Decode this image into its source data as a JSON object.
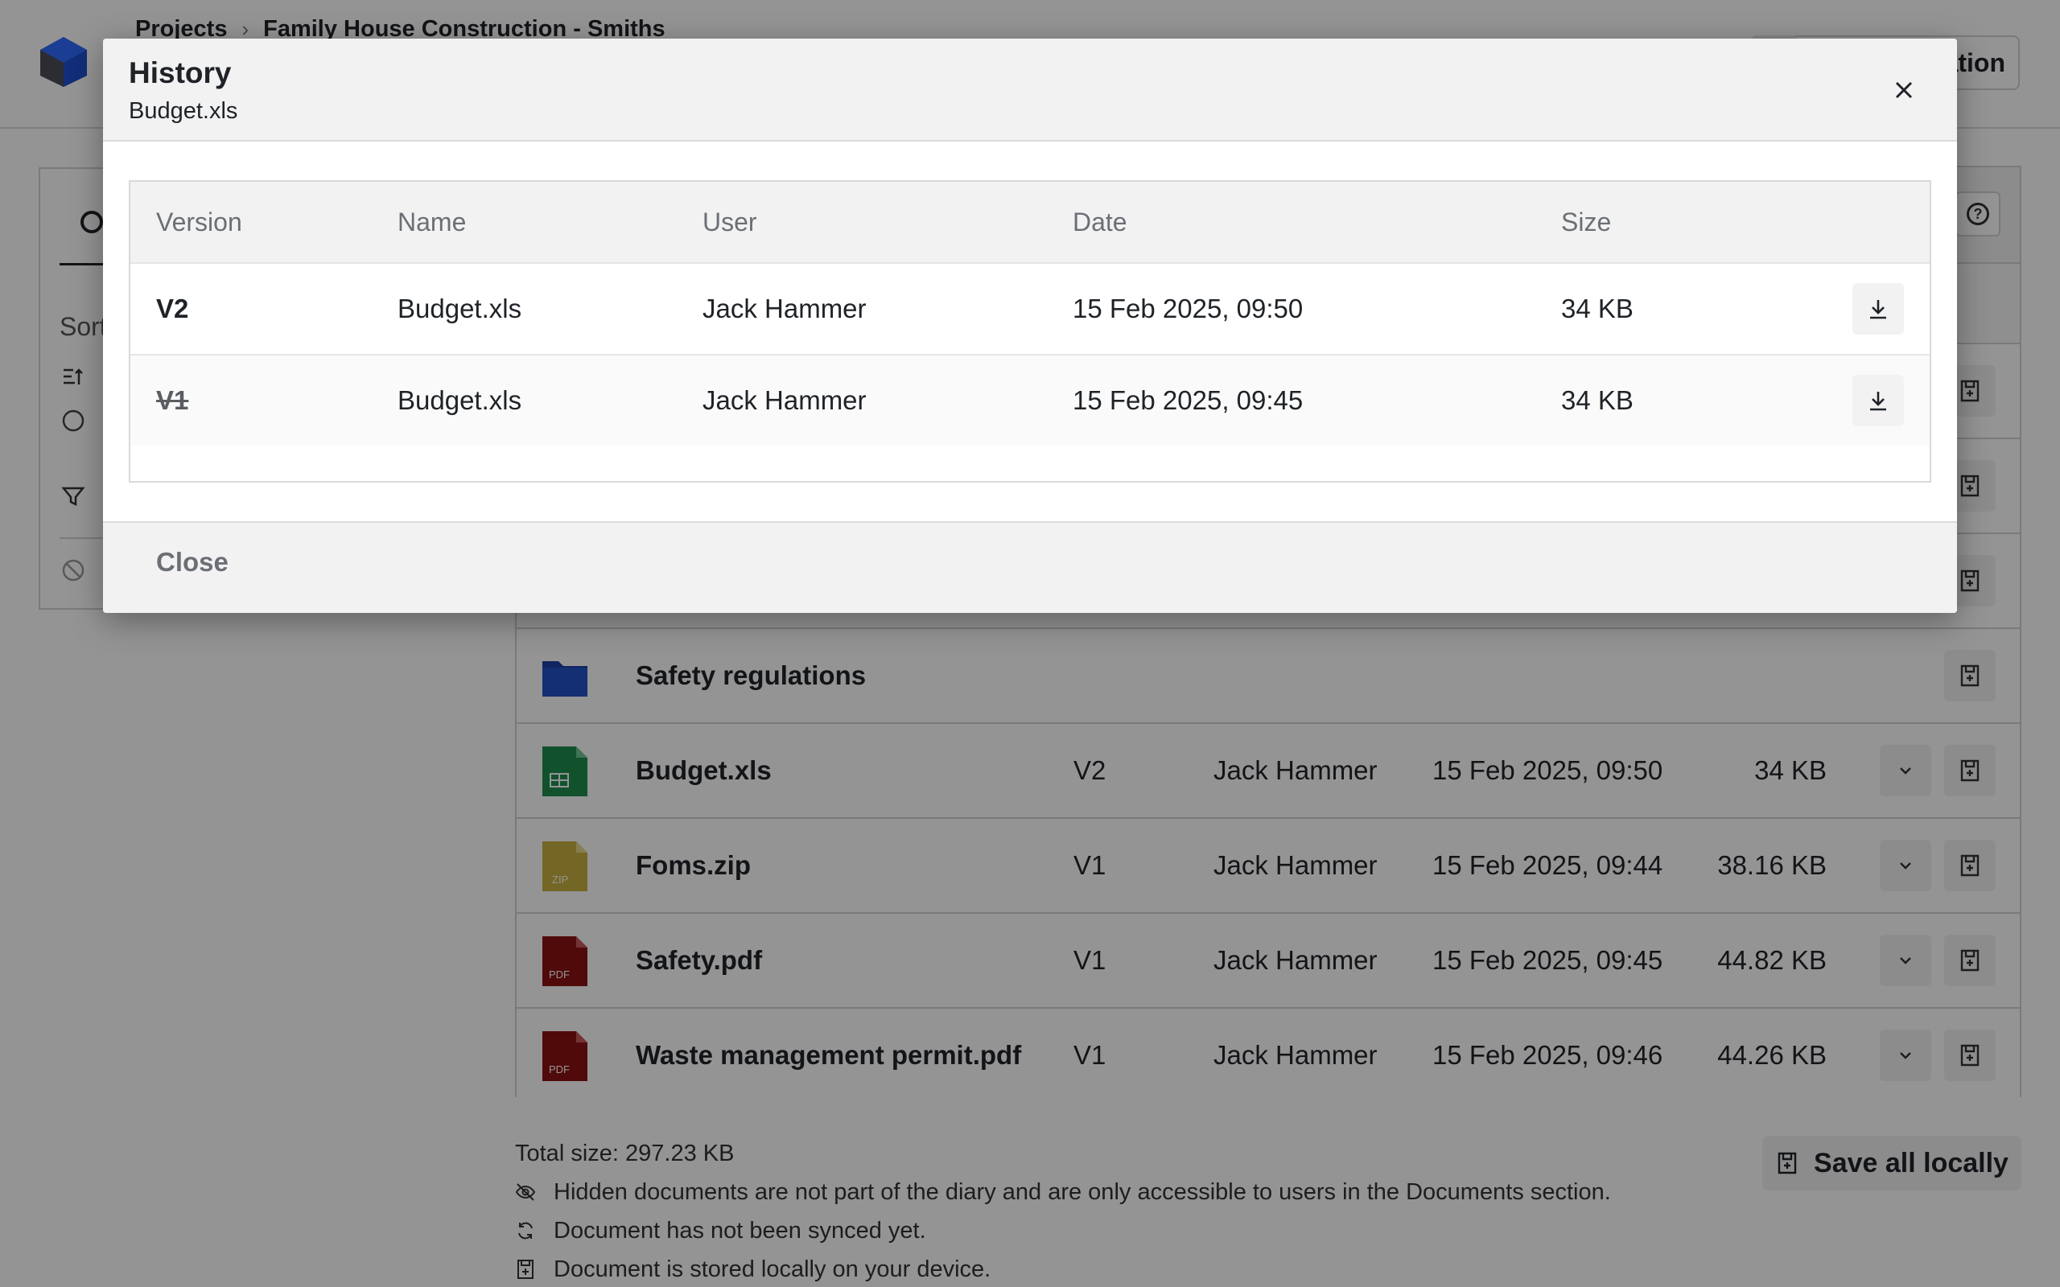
{
  "breadcrumb": {
    "root": "Projects",
    "sep": "›",
    "current": "Family House Construction - Smiths"
  },
  "topbar": {
    "action_label": "ation"
  },
  "sidebar": {
    "sort_label": "Sort"
  },
  "colors": {
    "brand_blue": "#1f4fd1",
    "xls_green": "#1e8e4e",
    "zip_yellow": "#c9b040",
    "pdf_red": "#8a1212",
    "folder_blue": "#1d3fa8"
  },
  "documents": {
    "rows": [
      {
        "name": "Safety regulations",
        "icon": "folder-icon",
        "version": "",
        "user": "",
        "date": "",
        "size": ""
      },
      {
        "name": "Budget.xls",
        "icon": "spreadsheet-icon",
        "version": "V2",
        "user": "Jack Hammer",
        "date": "15 Feb 2025, 09:50",
        "size": "34 KB"
      },
      {
        "name": "Foms.zip",
        "icon": "zip-icon",
        "version": "V1",
        "user": "Jack Hammer",
        "date": "15 Feb 2025, 09:44",
        "size": "38.16 KB"
      },
      {
        "name": "Safety.pdf",
        "icon": "pdf-icon",
        "version": "V1",
        "user": "Jack Hammer",
        "date": "15 Feb 2025, 09:45",
        "size": "44.82 KB"
      },
      {
        "name": "Waste management permit.pdf",
        "icon": "pdf-icon",
        "version": "V1",
        "user": "Jack Hammer",
        "date": "15 Feb 2025, 09:46",
        "size": "44.26 KB"
      }
    ]
  },
  "file_badges": {
    "zip": "ZIP",
    "pdf": "PDF"
  },
  "footer": {
    "total_size": "Total size: 297.23 KB",
    "hidden_note": "Hidden documents are not part of the diary and are only accessible to users in the Documents section.",
    "sync_note": "Document has not been synced yet.",
    "local_note": "Document is stored locally on your device.",
    "save_all_label": "Save all locally"
  },
  "modal": {
    "title": "History",
    "subtitle": "Budget.xls",
    "columns": {
      "version": "Version",
      "name": "Name",
      "user": "User",
      "date": "Date",
      "size": "Size"
    },
    "rows": [
      {
        "version": "V2",
        "name": "Budget.xls",
        "user": "Jack Hammer",
        "date": "15 Feb 2025, 09:50",
        "size": "34 KB",
        "current": true
      },
      {
        "version": "V1",
        "name": "Budget.xls",
        "user": "Jack Hammer",
        "date": "15 Feb 2025, 09:45",
        "size": "34 KB",
        "current": false
      }
    ],
    "close_label": "Close"
  }
}
